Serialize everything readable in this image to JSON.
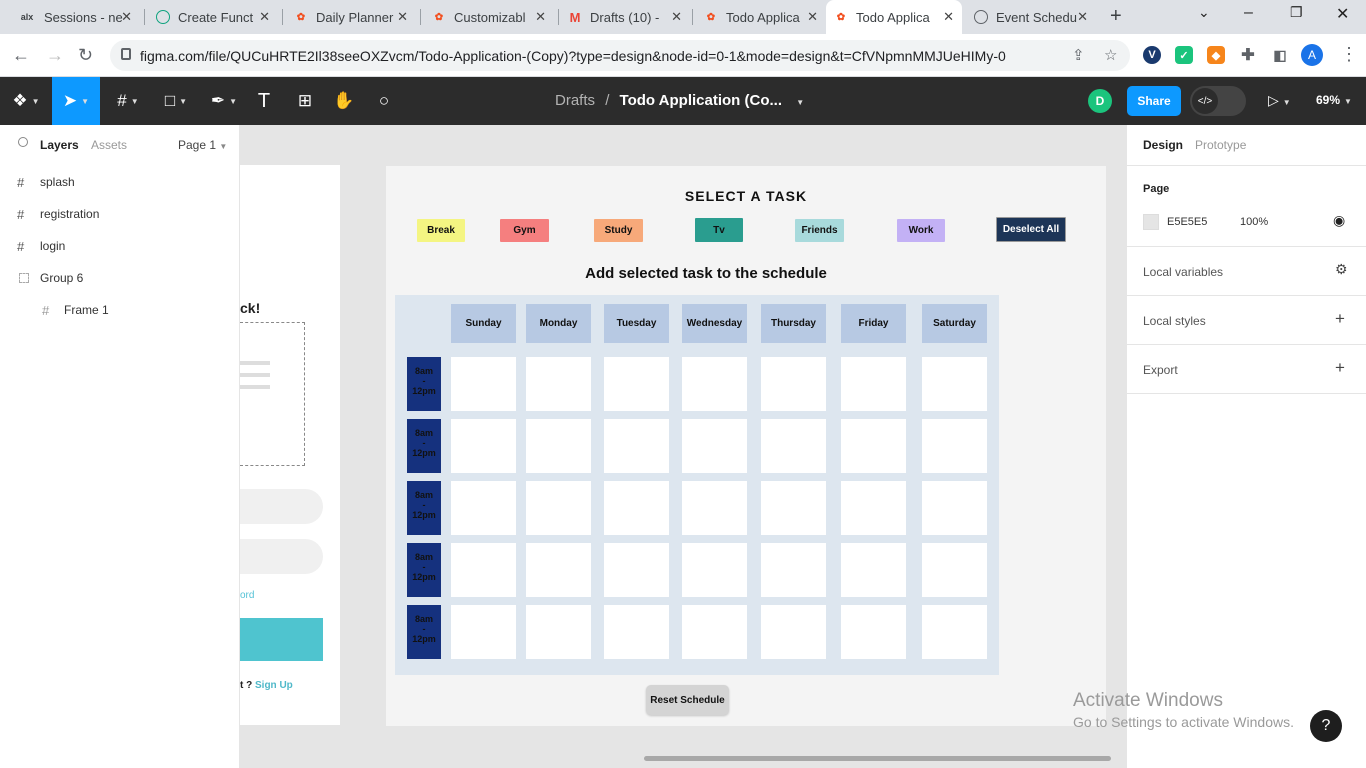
{
  "browser": {
    "tabs": [
      {
        "title": "Sessions - ne",
        "icon": "alx-icon"
      },
      {
        "title": "Create Funct",
        "icon": "chatgpt-icon"
      },
      {
        "title": "Daily Planner",
        "icon": "figma-icon"
      },
      {
        "title": "Customizabl",
        "icon": "figma-icon"
      },
      {
        "title": "Drafts (10) -",
        "icon": "gmail-icon"
      },
      {
        "title": "Todo Applica",
        "icon": "figma-icon"
      },
      {
        "title": "Todo Applica",
        "icon": "figma-icon",
        "active": true
      },
      {
        "title": "Event Schedu",
        "icon": "globe-icon"
      }
    ],
    "url": "figma.com/file/QUCuHRTE2Il38seeOXZvcm/Todo-Application-(Copy)?type=design&node-id=0-1&mode=design&t=CfVNpmnMMJUeHIMy-0",
    "profile_initial": "A",
    "ext_v": "V"
  },
  "figma": {
    "breadcrumb_parent": "Drafts",
    "breadcrumb_sep": "/",
    "file_name": "Todo Application (Co...",
    "user_initial": "D",
    "share_label": "Share",
    "zoom_label": "69%"
  },
  "left_panel": {
    "tab_layers": "Layers",
    "tab_assets": "Assets",
    "page_selector": "Page 1",
    "layers": [
      {
        "name": "splash"
      },
      {
        "name": "registration"
      },
      {
        "name": "login"
      },
      {
        "name": "Group 6"
      },
      {
        "name": "Frame 1"
      }
    ]
  },
  "canvas": {
    "login_fragments": {
      "heading": "ck!",
      "forgot": "ord",
      "signup_prefix": "t ? ",
      "signup_link": "Sign Up"
    },
    "title": "SELECT A TASK",
    "tasks": [
      {
        "label": "Break",
        "color": "#f4f582"
      },
      {
        "label": "Gym",
        "color": "#f57f7f"
      },
      {
        "label": "Study",
        "color": "#f7a97a"
      },
      {
        "label": "Tv",
        "color": "#2a9d8f"
      },
      {
        "label": "Friends",
        "color": "#a8dadc"
      },
      {
        "label": "Work",
        "color": "#c3b1f5"
      }
    ],
    "deselect_label": "Deselect All",
    "subtitle": "Add selected task to the schedule",
    "days": [
      "Sunday",
      "Monday",
      "Tuesday",
      "Wednesday",
      "Thursday",
      "Friday",
      "Saturday"
    ],
    "time_slots": [
      {
        "line1": "8am",
        "line2": "-",
        "line3": "12pm"
      },
      {
        "line1": "8am",
        "line2": "-",
        "line3": "12pm"
      },
      {
        "line1": "8am",
        "line2": "-",
        "line3": "12pm"
      },
      {
        "line1": "8am",
        "line2": "-",
        "line3": "12pm"
      },
      {
        "line1": "8am",
        "line2": "-",
        "line3": "12pm"
      }
    ],
    "reset_label": "Reset Schedule"
  },
  "right_panel": {
    "tab_design": "Design",
    "tab_prototype": "Prototype",
    "page_label": "Page",
    "page_color": "E5E5E5",
    "page_opacity": "100%",
    "local_variables": "Local variables",
    "local_styles": "Local styles",
    "export": "Export"
  },
  "watermark": {
    "line1": "Activate Windows",
    "line2": "Go to Settings to activate Windows."
  },
  "help_label": "?"
}
